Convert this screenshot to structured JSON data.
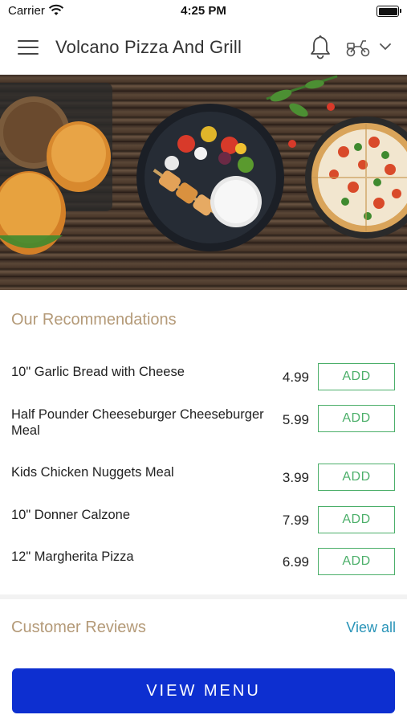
{
  "status_bar": {
    "carrier": "Carrier",
    "time": "4:25 PM"
  },
  "header": {
    "title": "Volcano Pizza And Grill"
  },
  "icons": {
    "menu": "hamburger-icon",
    "notifications": "bell-icon",
    "delivery": "scooter-icon",
    "dropdown": "chevron-down-icon"
  },
  "recommendations": {
    "title": "Our Recommendations",
    "items": [
      {
        "name": "10\" Garlic Bread with Cheese",
        "price": "4.99",
        "action": "ADD"
      },
      {
        "name": "Half Pounder Cheeseburger Cheeseburger Meal",
        "price": "5.99",
        "action": "ADD"
      },
      {
        "name": "Kids Chicken Nuggets Meal",
        "price": "3.99",
        "action": "ADD"
      },
      {
        "name": "10\" Donner Calzone",
        "price": "7.99",
        "action": "ADD"
      },
      {
        "name": "12\" Margherita Pizza",
        "price": "6.99",
        "action": "ADD"
      }
    ]
  },
  "reviews": {
    "title": "Customer Reviews",
    "view_all": "View all"
  },
  "footer": {
    "button_label": "VIEW MENU"
  },
  "colors": {
    "accent_green": "#4caf6a",
    "section_title": "#b49a78",
    "link": "#2a94b8",
    "primary_button": "#0d2fd0"
  }
}
